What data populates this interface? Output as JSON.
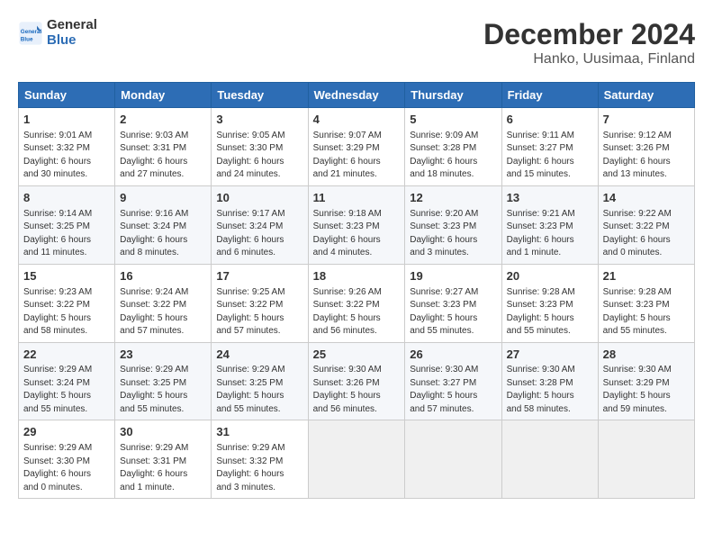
{
  "header": {
    "logo_line1": "General",
    "logo_line2": "Blue",
    "title": "December 2024",
    "subtitle": "Hanko, Uusimaa, Finland"
  },
  "days_of_week": [
    "Sunday",
    "Monday",
    "Tuesday",
    "Wednesday",
    "Thursday",
    "Friday",
    "Saturday"
  ],
  "weeks": [
    [
      {
        "day": "1",
        "info": "Sunrise: 9:01 AM\nSunset: 3:32 PM\nDaylight: 6 hours\nand 30 minutes."
      },
      {
        "day": "2",
        "info": "Sunrise: 9:03 AM\nSunset: 3:31 PM\nDaylight: 6 hours\nand 27 minutes."
      },
      {
        "day": "3",
        "info": "Sunrise: 9:05 AM\nSunset: 3:30 PM\nDaylight: 6 hours\nand 24 minutes."
      },
      {
        "day": "4",
        "info": "Sunrise: 9:07 AM\nSunset: 3:29 PM\nDaylight: 6 hours\nand 21 minutes."
      },
      {
        "day": "5",
        "info": "Sunrise: 9:09 AM\nSunset: 3:28 PM\nDaylight: 6 hours\nand 18 minutes."
      },
      {
        "day": "6",
        "info": "Sunrise: 9:11 AM\nSunset: 3:27 PM\nDaylight: 6 hours\nand 15 minutes."
      },
      {
        "day": "7",
        "info": "Sunrise: 9:12 AM\nSunset: 3:26 PM\nDaylight: 6 hours\nand 13 minutes."
      }
    ],
    [
      {
        "day": "8",
        "info": "Sunrise: 9:14 AM\nSunset: 3:25 PM\nDaylight: 6 hours\nand 11 minutes."
      },
      {
        "day": "9",
        "info": "Sunrise: 9:16 AM\nSunset: 3:24 PM\nDaylight: 6 hours\nand 8 minutes."
      },
      {
        "day": "10",
        "info": "Sunrise: 9:17 AM\nSunset: 3:24 PM\nDaylight: 6 hours\nand 6 minutes."
      },
      {
        "day": "11",
        "info": "Sunrise: 9:18 AM\nSunset: 3:23 PM\nDaylight: 6 hours\nand 4 minutes."
      },
      {
        "day": "12",
        "info": "Sunrise: 9:20 AM\nSunset: 3:23 PM\nDaylight: 6 hours\nand 3 minutes."
      },
      {
        "day": "13",
        "info": "Sunrise: 9:21 AM\nSunset: 3:23 PM\nDaylight: 6 hours\nand 1 minute."
      },
      {
        "day": "14",
        "info": "Sunrise: 9:22 AM\nSunset: 3:22 PM\nDaylight: 6 hours\nand 0 minutes."
      }
    ],
    [
      {
        "day": "15",
        "info": "Sunrise: 9:23 AM\nSunset: 3:22 PM\nDaylight: 5 hours\nand 58 minutes."
      },
      {
        "day": "16",
        "info": "Sunrise: 9:24 AM\nSunset: 3:22 PM\nDaylight: 5 hours\nand 57 minutes."
      },
      {
        "day": "17",
        "info": "Sunrise: 9:25 AM\nSunset: 3:22 PM\nDaylight: 5 hours\nand 57 minutes."
      },
      {
        "day": "18",
        "info": "Sunrise: 9:26 AM\nSunset: 3:22 PM\nDaylight: 5 hours\nand 56 minutes."
      },
      {
        "day": "19",
        "info": "Sunrise: 9:27 AM\nSunset: 3:23 PM\nDaylight: 5 hours\nand 55 minutes."
      },
      {
        "day": "20",
        "info": "Sunrise: 9:28 AM\nSunset: 3:23 PM\nDaylight: 5 hours\nand 55 minutes."
      },
      {
        "day": "21",
        "info": "Sunrise: 9:28 AM\nSunset: 3:23 PM\nDaylight: 5 hours\nand 55 minutes."
      }
    ],
    [
      {
        "day": "22",
        "info": "Sunrise: 9:29 AM\nSunset: 3:24 PM\nDaylight: 5 hours\nand 55 minutes."
      },
      {
        "day": "23",
        "info": "Sunrise: 9:29 AM\nSunset: 3:25 PM\nDaylight: 5 hours\nand 55 minutes."
      },
      {
        "day": "24",
        "info": "Sunrise: 9:29 AM\nSunset: 3:25 PM\nDaylight: 5 hours\nand 55 minutes."
      },
      {
        "day": "25",
        "info": "Sunrise: 9:30 AM\nSunset: 3:26 PM\nDaylight: 5 hours\nand 56 minutes."
      },
      {
        "day": "26",
        "info": "Sunrise: 9:30 AM\nSunset: 3:27 PM\nDaylight: 5 hours\nand 57 minutes."
      },
      {
        "day": "27",
        "info": "Sunrise: 9:30 AM\nSunset: 3:28 PM\nDaylight: 5 hours\nand 58 minutes."
      },
      {
        "day": "28",
        "info": "Sunrise: 9:30 AM\nSunset: 3:29 PM\nDaylight: 5 hours\nand 59 minutes."
      }
    ],
    [
      {
        "day": "29",
        "info": "Sunrise: 9:29 AM\nSunset: 3:30 PM\nDaylight: 6 hours\nand 0 minutes."
      },
      {
        "day": "30",
        "info": "Sunrise: 9:29 AM\nSunset: 3:31 PM\nDaylight: 6 hours\nand 1 minute."
      },
      {
        "day": "31",
        "info": "Sunrise: 9:29 AM\nSunset: 3:32 PM\nDaylight: 6 hours\nand 3 minutes."
      },
      {
        "day": "",
        "info": ""
      },
      {
        "day": "",
        "info": ""
      },
      {
        "day": "",
        "info": ""
      },
      {
        "day": "",
        "info": ""
      }
    ]
  ]
}
